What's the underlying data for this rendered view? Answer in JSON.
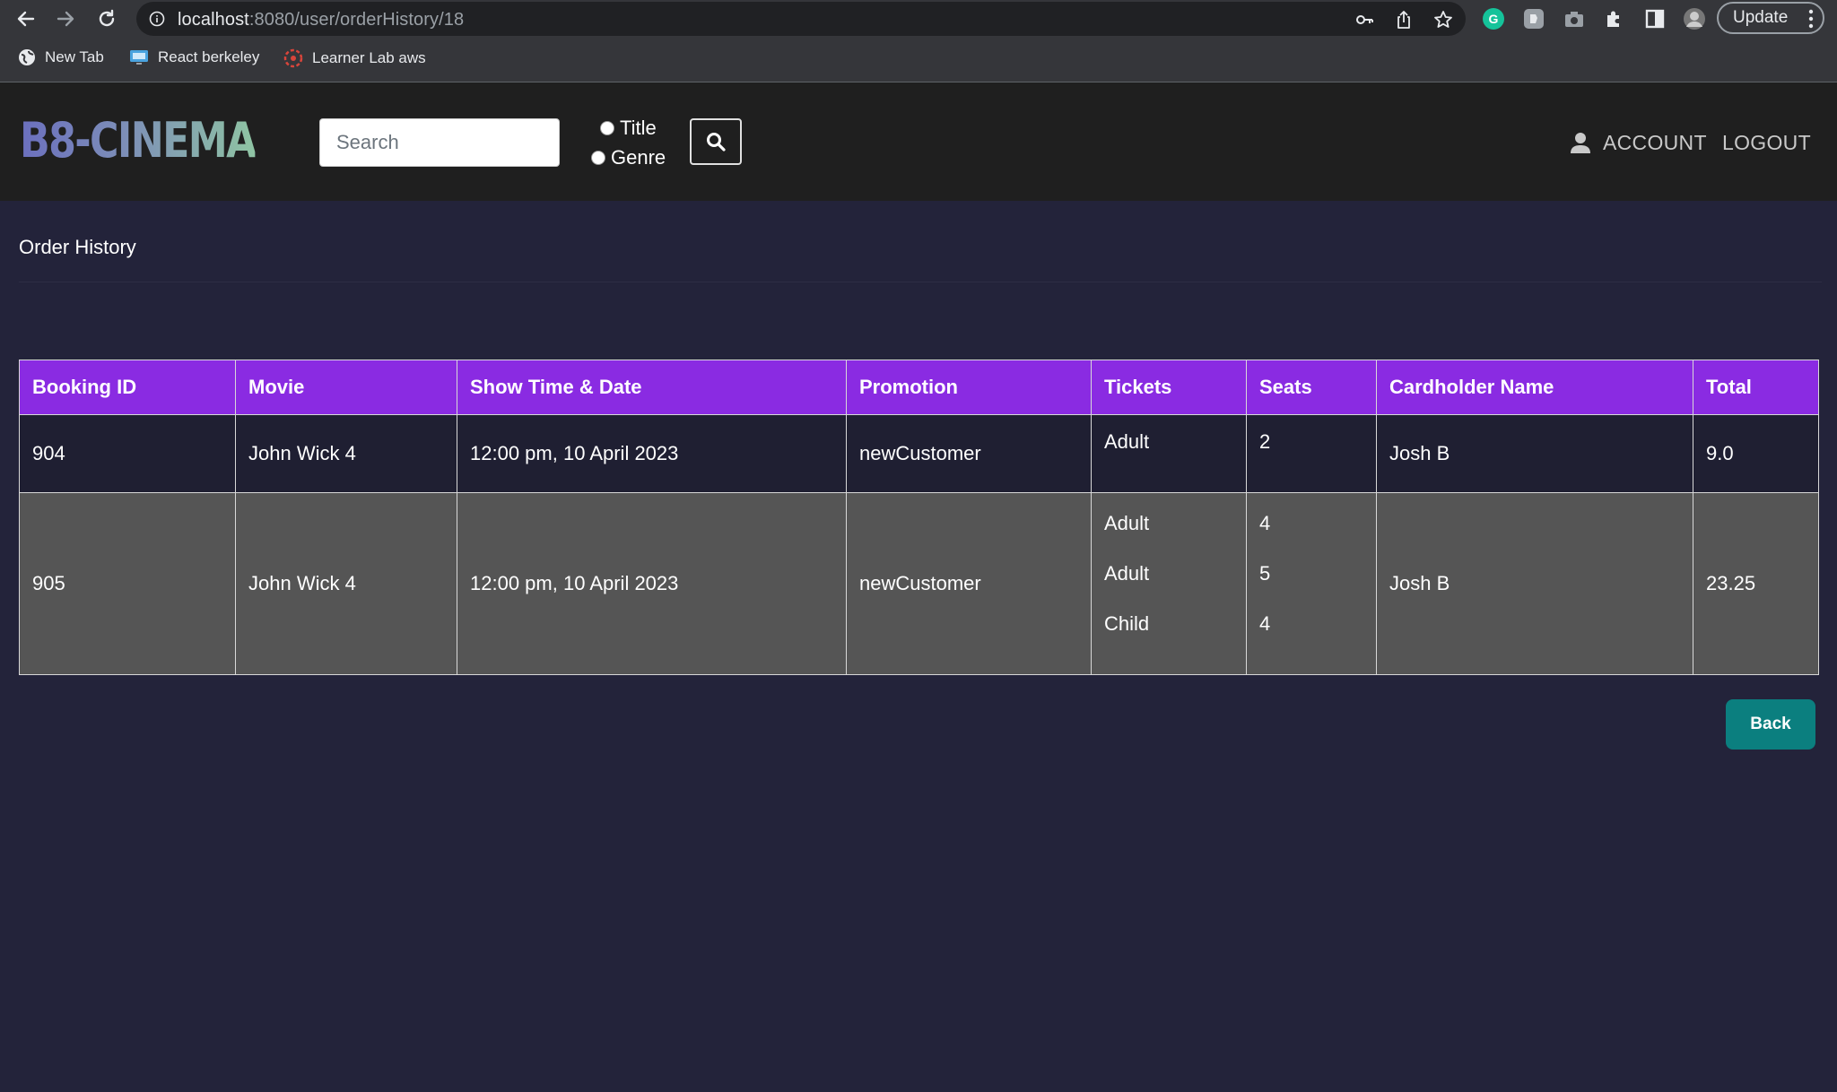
{
  "browser": {
    "url_host": "localhost",
    "url_path": ":8080/user/orderHistory/18",
    "update_label": "Update",
    "bookmarks": [
      {
        "label": "New Tab",
        "icon": "globe-icon"
      },
      {
        "label": "React berkeley",
        "icon": "monitor-icon"
      },
      {
        "label": "Learner Lab aws",
        "icon": "aws-icon"
      }
    ]
  },
  "header": {
    "logo": "B8-CINEMA",
    "search_placeholder": "Search",
    "filter_options": [
      "Title",
      "Genre"
    ],
    "account_label": "ACCOUNT",
    "logout_label": "LOGOUT"
  },
  "main": {
    "title": "Order History",
    "columns": [
      "Booking ID",
      "Movie",
      "Show Time & Date",
      "Promotion",
      "Tickets",
      "Seats",
      "Cardholder Name",
      "Total"
    ],
    "orders": [
      {
        "booking_id": "904",
        "movie": "John Wick 4",
        "showtime": "12:00 pm, 10 April 2023",
        "promotion": "newCustomer",
        "tickets": [
          "Adult"
        ],
        "seats": [
          "2"
        ],
        "cardholder": "Josh B",
        "total": "9.0"
      },
      {
        "booking_id": "905",
        "movie": "John Wick 4",
        "showtime": "12:00 pm, 10 April 2023",
        "promotion": "newCustomer",
        "tickets": [
          "Adult",
          "Adult",
          "Child"
        ],
        "seats": [
          "4",
          "5",
          "4"
        ],
        "cardholder": "Josh B",
        "total": "23.25"
      }
    ],
    "back_label": "Back"
  },
  "colors": {
    "page_bg": "#23233a",
    "header_bg": "#1f1f1f",
    "table_header": "#8a2be2",
    "row_dark": "#1f1f32",
    "row_grey": "#555555",
    "back_button": "#0b7f7f"
  }
}
